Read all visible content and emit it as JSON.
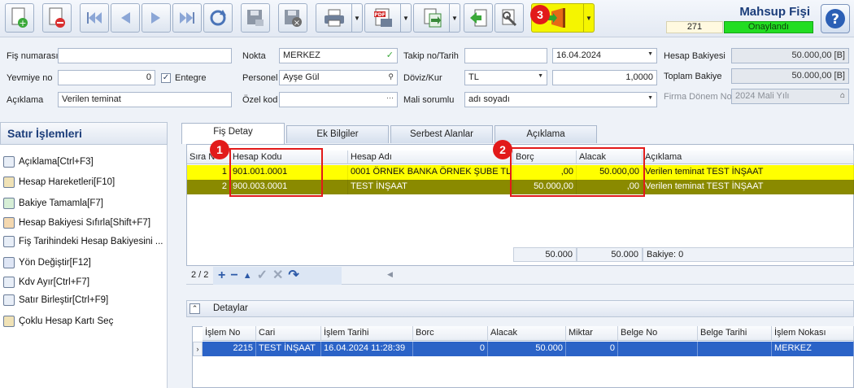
{
  "window": {
    "title": "Mahsup Fişi",
    "record_count": "271",
    "status": "Onaylandı",
    "status_color": "#22dd22"
  },
  "toolbar": {
    "buttons": [
      "new-icon",
      "delete-icon",
      "first-icon",
      "prev-icon",
      "next-icon",
      "last-icon",
      "refresh-icon",
      "save-icon",
      "cancel-icon",
      "print-icon",
      "pdf-icon",
      "export-icon",
      "import-icon",
      "tools-icon",
      "exit-icon",
      "help-icon"
    ]
  },
  "form": {
    "fis_numarasi_label": "Fiş numarası",
    "fis_numarasi_value": "",
    "yevmiye_label": "Yevmiye no",
    "yevmiye_value": "0",
    "entegre_label": "Entegre",
    "entegre_checked": true,
    "aciklama_label": "Açıklama",
    "aciklama_value": "Verilen teminat",
    "nokta_label": "Nokta",
    "nokta_value": "MERKEZ",
    "personel_label": "Personel",
    "personel_value": "Ayşe Gül",
    "ozel_kod_label": "Özel kod",
    "ozel_kod_value": "",
    "takip_label": "Takip no/Tarih",
    "takip_value": "",
    "tarih_value": "16.04.2024",
    "doviz_label": "Döviz/Kur",
    "doviz_value": "TL",
    "kur_value": "1,0000",
    "mali_label": "Mali sorumlu",
    "mali_value": "adı soyadı",
    "hesap_bakiyesi_label": "Hesap Bakiyesi",
    "hesap_bakiyesi_value": "50.000,00 [B]",
    "toplam_bakiye_label": "Toplam Bakiye",
    "toplam_bakiye_value": "50.000,00 [B]",
    "firma_donem_label": "Firma Dönem No",
    "firma_donem_value": "2024 Mali Yılı"
  },
  "sidebar": {
    "title": "Satır İşlemleri",
    "items": [
      "Açıklama[Ctrl+F3]",
      "Hesap Hareketleri[F10]",
      "Bakiye Tamamla[F7]",
      "Hesap Bakiyesi Sıfırla[Shift+F7]",
      "Fiş Tarihindeki Hesap Bakiyesini ...",
      "Yön Değiştir[F12]",
      "Kdv Ayır[Ctrl+F7]",
      "Satır Birleştir[Ctrl+F9]",
      "Çoklu Hesap Kartı Seç"
    ]
  },
  "tabs": [
    "Fiş Detay",
    "Ek Bilgiler",
    "Serbest Alanlar",
    "Açıklama"
  ],
  "grid": {
    "headers": [
      "Sıra N",
      "Hesap Kodu",
      "Hesap Adı",
      "Borç",
      "Alacak",
      "Açıklama"
    ],
    "rows": [
      {
        "sira": "1",
        "kod": "901.001.0001",
        "ad": "0001 ÖRNEK BANKA ÖRNEK ŞUBE TL",
        "borc": ",00",
        "alacak": "50.000,00",
        "aciklama": "Verilen teminat TEST İNŞAAT"
      },
      {
        "sira": "2",
        "kod": "900.003.0001",
        "ad": "TEST İNŞAAT",
        "borc": "50.000,00",
        "alacak": ",00",
        "aciklama": "Verilen teminat TEST İNŞAAT"
      }
    ],
    "total_borc": "50.000",
    "total_alacak": "50.000",
    "bakiye": "Bakiye: 0",
    "nav_count": "2 / 2"
  },
  "details": {
    "title": "Detaylar",
    "headers": [
      "İşlem No",
      "Cari",
      "İşlem Tarihi",
      "Borc",
      "Alacak",
      "Miktar",
      "Belge No",
      "Belge Tarihi",
      "İşlem Nokası"
    ],
    "row": {
      "islem_no": "2215",
      "cari": "TEST İNŞAAT",
      "tarih": "16.04.2024 11:28:39",
      "borc": "0",
      "alacak": "50.000",
      "miktar": "0",
      "belge_no": "",
      "belge_tarihi": "",
      "nokta": "MERKEZ"
    }
  },
  "annotations": [
    "1",
    "2",
    "3"
  ]
}
